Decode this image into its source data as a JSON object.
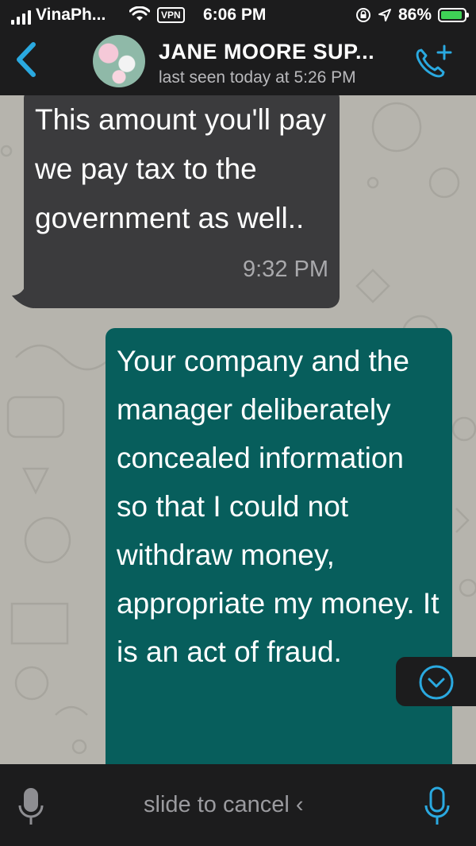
{
  "status_bar": {
    "carrier": "VinaPh...",
    "vpn_label": "VPN",
    "time": "6:06 PM",
    "battery_percent": "86%",
    "battery_level": 0.86,
    "accent_battery": "#3fd156"
  },
  "header": {
    "contact_name": "JANE MOORE SUP...",
    "last_seen": "last seen today at 5:26 PM",
    "accent": "#2aa9e0"
  },
  "messages": [
    {
      "direction": "incoming",
      "text": "This amount you'll pay we pay tax to the government as well..",
      "time": "9:32 PM"
    },
    {
      "direction": "outgoing",
      "text": "Your company and the manager deliberately concealed information so that I could not withdraw money, appropriate my money. It is an act of fraud."
    }
  ],
  "input_bar": {
    "slide_to_cancel": "slide to cancel",
    "cancel_chevron": "‹"
  },
  "icons": [
    "signal-bars-icon",
    "wifi-icon",
    "lock-rotation-icon",
    "location-arrow-icon",
    "battery-charging-icon",
    "back-chevron-icon",
    "call-add-icon",
    "scroll-down-icon",
    "mic-icon"
  ]
}
